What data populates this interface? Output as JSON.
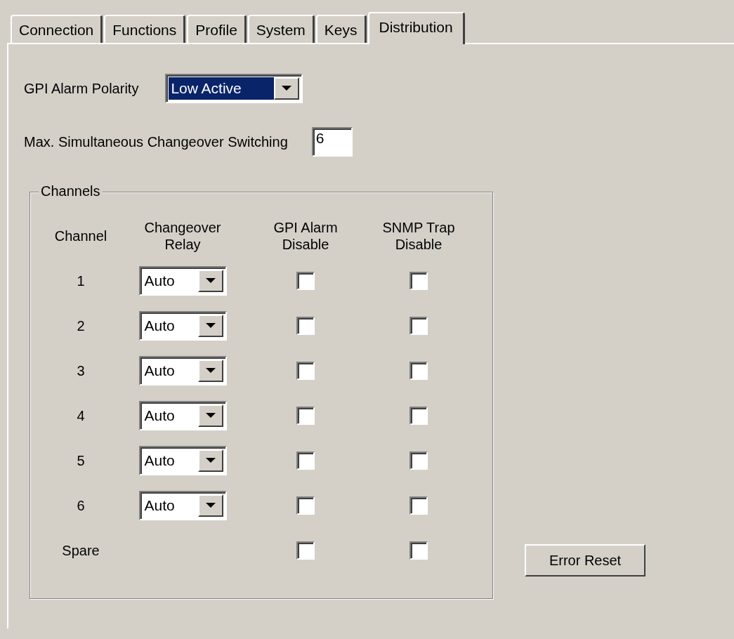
{
  "tabs": [
    {
      "label": "Connection",
      "selected": false
    },
    {
      "label": "Functions",
      "selected": false
    },
    {
      "label": "Profile",
      "selected": false
    },
    {
      "label": "System",
      "selected": false
    },
    {
      "label": "Keys",
      "selected": false
    },
    {
      "label": "Distribution",
      "selected": true
    }
  ],
  "gpi_alarm_polarity": {
    "label": "GPI Alarm Polarity",
    "value": "Low Active",
    "focused": true
  },
  "max_switching": {
    "label": "Max. Simultaneous Changeover Switching",
    "value": "6"
  },
  "channels": {
    "title": "Channels",
    "columns": [
      "Channel",
      "Changeover Relay",
      "GPI Alarm Disable",
      "SNMP Trap Disable"
    ],
    "rows": [
      {
        "channel": "1",
        "relay": "Auto",
        "gpi_alarm_disable": false,
        "snmp_trap_disable": false
      },
      {
        "channel": "2",
        "relay": "Auto",
        "gpi_alarm_disable": false,
        "snmp_trap_disable": false
      },
      {
        "channel": "3",
        "relay": "Auto",
        "gpi_alarm_disable": false,
        "snmp_trap_disable": false
      },
      {
        "channel": "4",
        "relay": "Auto",
        "gpi_alarm_disable": false,
        "snmp_trap_disable": false
      },
      {
        "channel": "5",
        "relay": "Auto",
        "gpi_alarm_disable": false,
        "snmp_trap_disable": false
      },
      {
        "channel": "6",
        "relay": "Auto",
        "gpi_alarm_disable": false,
        "snmp_trap_disable": false
      },
      {
        "channel": "Spare",
        "gpi_alarm_disable": false,
        "snmp_trap_disable": false
      }
    ]
  },
  "error_reset_button": "Error Reset"
}
